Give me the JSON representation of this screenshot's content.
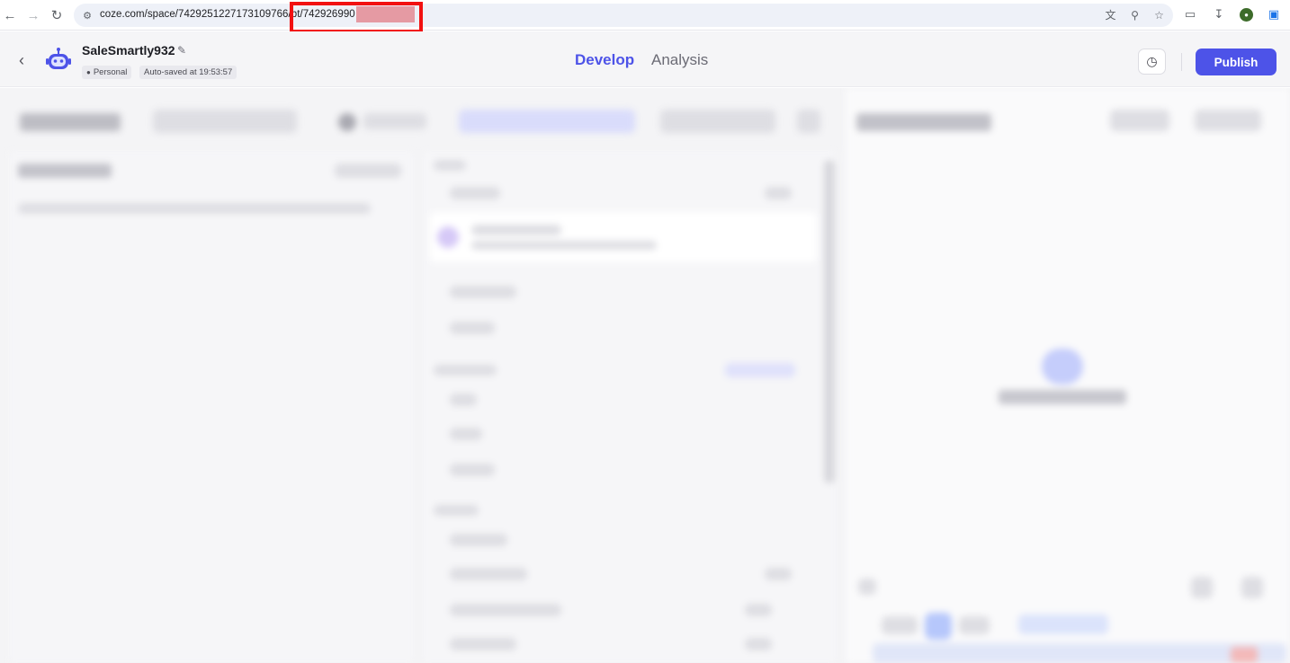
{
  "browser": {
    "url_visible": "coze.com/space/7429251227173109766/bot/742926990",
    "url_prefix": "coze.com/space/7429251227173109766/b",
    "url_highlight": "t/742926990"
  },
  "header": {
    "bot_name": "SaleSmartly932",
    "scope_badge": "Personal",
    "autosave_text": "Auto-saved at 19:53:57",
    "tabs": [
      {
        "label": "Develop",
        "active": true
      },
      {
        "label": "Analysis",
        "active": false
      }
    ],
    "publish_label": "Publish"
  },
  "colors": {
    "accent": "#4d53e8",
    "highlight_box": "#f21111"
  },
  "icons": {
    "back": "chevron-left-icon",
    "forward": "arrow-right-icon",
    "reload": "reload-icon",
    "site_info": "tune-icon",
    "translate": "translate-icon",
    "zoom": "zoom-icon",
    "bookmark": "star-icon",
    "extensions": "puzzle-icon",
    "download": "download-icon",
    "lens": "lens-icon",
    "edit": "edit-icon",
    "history": "history-icon",
    "person": "person-icon"
  }
}
